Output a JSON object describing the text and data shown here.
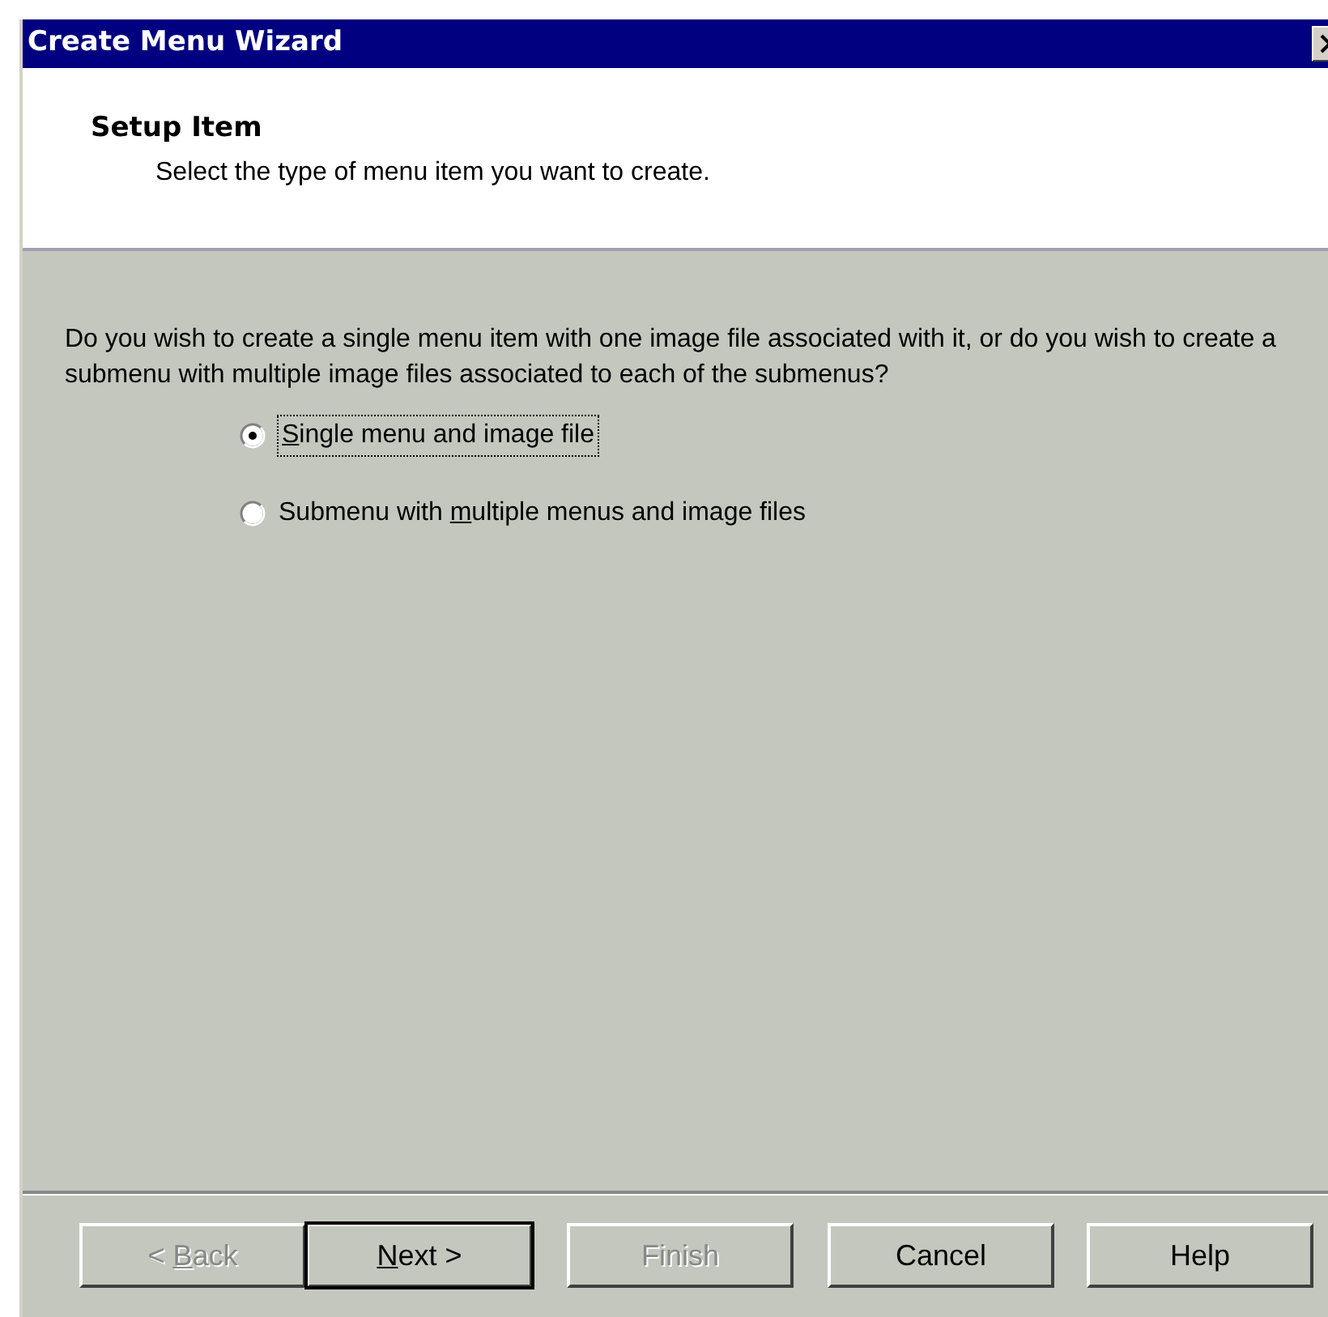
{
  "window": {
    "title": "Create Menu Wizard"
  },
  "header": {
    "title": "Setup Item",
    "subtitle": "Select the type of menu item you want to create."
  },
  "question": "Do you wish to create a single menu item with one image file associated with it, or do you wish to create a submenu with multiple image files associated to each of the submenus?",
  "options": [
    {
      "access_key": "S",
      "label_end": "ingle menu and image file",
      "selected": true
    },
    {
      "label_start": "Submenu with ",
      "access_key": "m",
      "label_end": "ultiple menus and image files",
      "selected": false
    }
  ],
  "buttons": [
    {
      "label_start": "< ",
      "access_key": "B",
      "label_end": "ack",
      "disabled": true,
      "default": false
    },
    {
      "access_key": "N",
      "label_end": "ext >",
      "disabled": false,
      "default": true
    },
    {
      "label_end": "Finish",
      "disabled": true,
      "default": false
    },
    {
      "label_end": "Cancel",
      "disabled": false,
      "default": false
    },
    {
      "label_end": "Help",
      "disabled": false,
      "default": false
    }
  ]
}
